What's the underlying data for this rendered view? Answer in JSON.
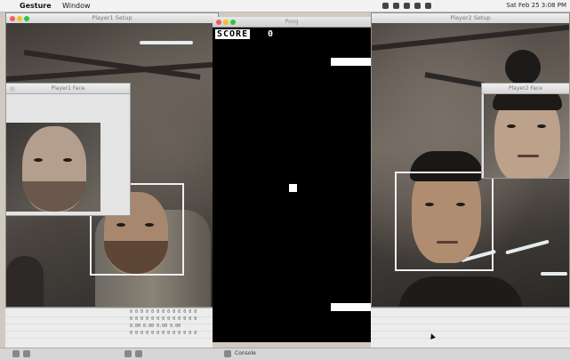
{
  "menubar": {
    "apple_glyph": "",
    "app_name": "Gesture",
    "menu_item": "Window",
    "status_time": "Sat Feb 25 3:08 PM"
  },
  "left_window": {
    "title": "Player1 Setup"
  },
  "left_panel": {
    "title": "Player1 Face"
  },
  "game_window": {
    "title": "Pong",
    "score_label": "SCORE",
    "score_value": "0"
  },
  "right_window": {
    "title": "Player2 Setup"
  },
  "right_panel": {
    "title": "Player2 Face"
  },
  "console": {
    "lines": [
      "0 0 0 0 0 0 0 0 0 0 0 0 0",
      "0 0 0 0 0 0 0 0 0 0 0 0 0",
      "0.00 0.00 0.00 0.00",
      "0 0 0 0 0 0 0 0 0 0 0 0 0"
    ]
  },
  "dock": {
    "label": "Console"
  },
  "colors": {
    "game_bg": "#000000",
    "paddle": "#ffffff",
    "face_box": "#f0f0f0"
  }
}
